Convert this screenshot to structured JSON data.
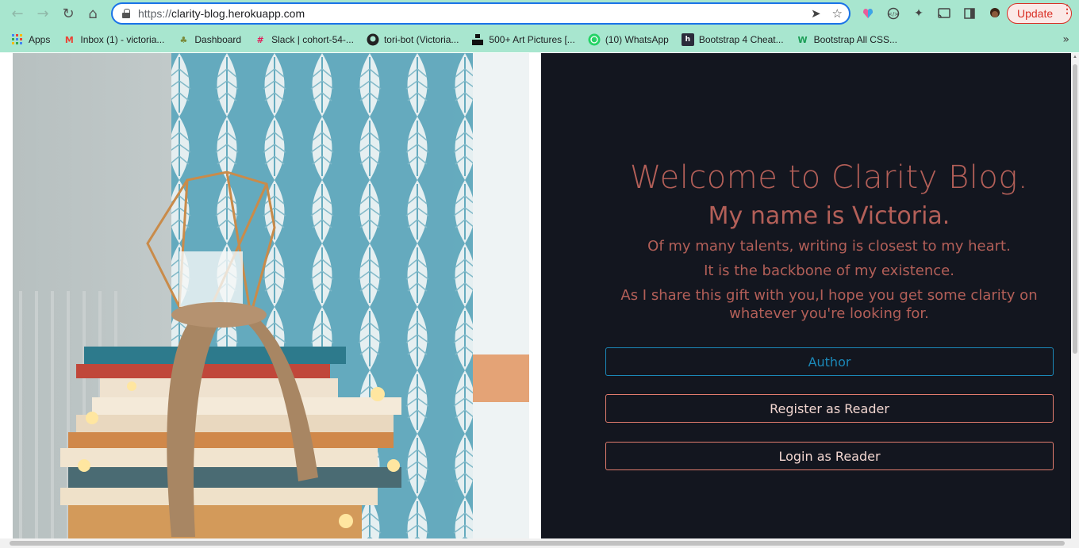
{
  "browser": {
    "url_scheme": "https://",
    "url_host": "clarity-blog.herokuapp.com",
    "update_label": "Update",
    "bookmarks": [
      {
        "label": "Apps",
        "icon": "apps-grid-icon",
        "color": "#4285f4"
      },
      {
        "label": "Inbox (1) - victoria...",
        "icon": "gmail-icon",
        "color": "#ea4335"
      },
      {
        "label": "Dashboard",
        "icon": "dashboard-icon",
        "color": "#7a8a3a"
      },
      {
        "label": "Slack | cohort-54-...",
        "icon": "slack-icon",
        "color": "#611f69"
      },
      {
        "label": "tori-bot (Victoria...",
        "icon": "github-icon",
        "color": "#222222"
      },
      {
        "label": "500+ Art Pictures [...",
        "icon": "unsplash-icon",
        "color": "#111111"
      },
      {
        "label": "(10) WhatsApp",
        "icon": "whatsapp-icon",
        "color": "#25d366"
      },
      {
        "label": "Bootstrap 4 Cheat...",
        "icon": "hackerthemes-icon",
        "color": "#2b2b3a"
      },
      {
        "label": "Bootstrap All CSS...",
        "icon": "w3-icon",
        "color": "#1a9d55"
      }
    ]
  },
  "hero": {
    "welcome": "Welcome to Clarity Blog.",
    "name_line": "My name is Victoria.",
    "line1": "Of my many talents, writing is closest to my heart.",
    "line2": "It is the backbone of my existence.",
    "line3": "As I share this gift with you,I hope you get some clarity on whatever you're looking for."
  },
  "actions": {
    "author": "Author",
    "register": "Register as Reader",
    "login": "Login as Reader"
  },
  "colors": {
    "panel_bg": "#13161f",
    "accent_text": "#b35f58",
    "author_border": "#1b88b8",
    "reader_border": "#e27c6e"
  }
}
